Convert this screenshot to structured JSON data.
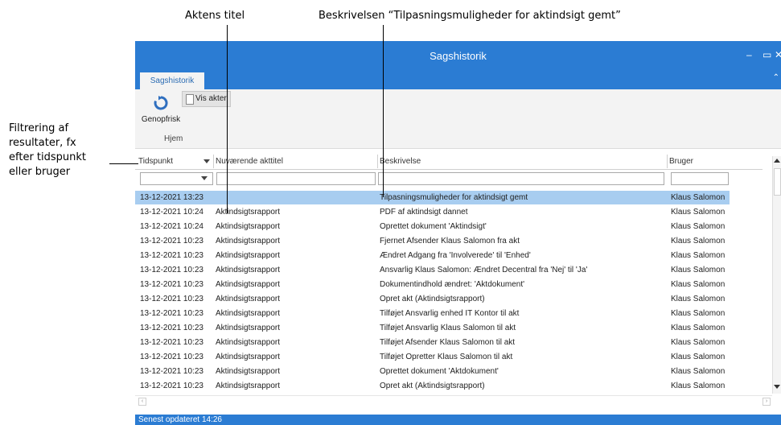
{
  "annotations": {
    "title_callout": "Aktens titel",
    "description_callout": "Beskrivelsen “Tilpasningsmuligheder for aktindsigt gemt”",
    "filter_callout": [
      "Filtrering af",
      "resultater, fx",
      "efter tidspunkt",
      "eller bruger"
    ]
  },
  "window": {
    "title": "Sagshistorik",
    "minimize_glyph": "–",
    "maximize_glyph": "▭",
    "close_glyph": "✕",
    "collapse_glyph": "⌃"
  },
  "ribbon": {
    "tab": "Sagshistorik",
    "refresh_label": "Genopfrisk",
    "show_docs_label": "Vis akter",
    "group_label": "Hjem"
  },
  "grid": {
    "columns": [
      "Tidspunkt",
      "Nuværende akttitel",
      "Beskrivelse",
      "Bruger"
    ],
    "rows": [
      {
        "time": "13-12-2021 13:23",
        "title": "",
        "description": "Tilpasningsmuligheder for aktindsigt gemt",
        "user": "Klaus Salomon",
        "selected": true
      },
      {
        "time": "13-12-2021 10:24",
        "title": "Aktindsigtsrapport",
        "description": "PDF af aktindsigt dannet",
        "user": "Klaus Salomon"
      },
      {
        "time": "13-12-2021 10:24",
        "title": "Aktindsigtsrapport",
        "description": "Oprettet dokument 'Aktindsigt'",
        "user": "Klaus Salomon"
      },
      {
        "time": "13-12-2021 10:23",
        "title": "Aktindsigtsrapport",
        "description": "Fjernet Afsender Klaus Salomon fra akt",
        "user": "Klaus Salomon"
      },
      {
        "time": "13-12-2021 10:23",
        "title": "Aktindsigtsrapport",
        "description": "Ændret Adgang fra 'Involverede' til 'Enhed'",
        "user": "Klaus Salomon"
      },
      {
        "time": "13-12-2021 10:23",
        "title": "Aktindsigtsrapport",
        "description": "Ansvarlig Klaus Salomon: Ændret Decentral fra 'Nej' til 'Ja'",
        "user": "Klaus Salomon"
      },
      {
        "time": "13-12-2021 10:23",
        "title": "Aktindsigtsrapport",
        "description": "Dokumentindhold ændret: 'Aktdokument'",
        "user": "Klaus Salomon"
      },
      {
        "time": "13-12-2021 10:23",
        "title": "Aktindsigtsrapport",
        "description": "Opret akt (Aktindsigtsrapport)",
        "user": "Klaus Salomon"
      },
      {
        "time": "13-12-2021 10:23",
        "title": "Aktindsigtsrapport",
        "description": "Tilføjet Ansvarlig enhed IT Kontor til akt",
        "user": "Klaus Salomon"
      },
      {
        "time": "13-12-2021 10:23",
        "title": "Aktindsigtsrapport",
        "description": "Tilføjet Ansvarlig Klaus Salomon til akt",
        "user": "Klaus Salomon"
      },
      {
        "time": "13-12-2021 10:23",
        "title": "Aktindsigtsrapport",
        "description": "Tilføjet Afsender Klaus Salomon til akt",
        "user": "Klaus Salomon"
      },
      {
        "time": "13-12-2021 10:23",
        "title": "Aktindsigtsrapport",
        "description": "Tilføjet Opretter Klaus Salomon til akt",
        "user": "Klaus Salomon"
      },
      {
        "time": "13-12-2021 10:23",
        "title": "Aktindsigtsrapport",
        "description": "Oprettet dokument 'Aktdokument'",
        "user": "Klaus Salomon"
      },
      {
        "time": "13-12-2021 10:23",
        "title": "Aktindsigtsrapport",
        "description": "Opret akt (Aktindsigtsrapport)",
        "user": "Klaus Salomon"
      }
    ]
  },
  "status": {
    "text": "Senest opdateret 14:26"
  },
  "colors": {
    "accent": "#2b7cd3",
    "selection": "#a8cdf0"
  }
}
